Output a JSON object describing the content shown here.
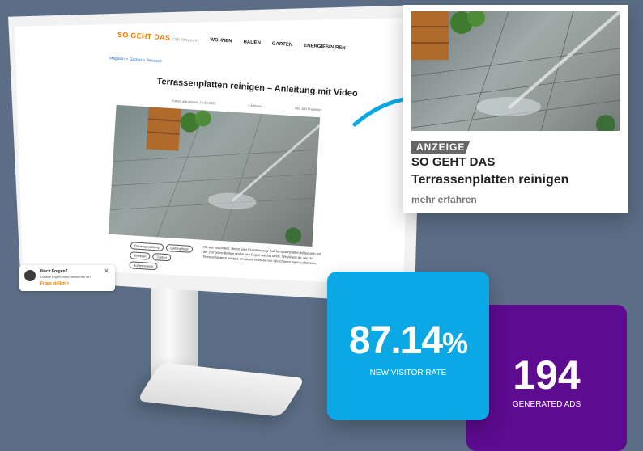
{
  "site": {
    "logo": "SO GEHT DAS",
    "logo_sub": "OBI Magazin",
    "nav": [
      "WOHNEN",
      "BAUEN",
      "GARTEN",
      "ENERGIESPAREN"
    ],
    "breadcrumb": "Magazin  >  Garten  >  Terrasse",
    "headline": "Terrassenplatten reinigen – Anleitung mit Video",
    "meta": [
      "Zuletzt aktualisiert: 15.08.2023",
      "5 Minuten",
      "inkl. 100 Projekten"
    ],
    "tags": [
      "Gartengestaltung",
      "Gartenpflege",
      "Terrasse",
      "Garten",
      "Außenbereich"
    ],
    "lead": "Ob aus Naturstein, Beton oder Feinsteinzeug: Auf Terrassenplatten bilden sich mit der Zeit grüne Beläge und in den Fugen wächst Moos. Wir zeigen dir, wie du Terrassenplatten reinigst, um deine Terrasse von Verschmutzungen zu befreien.",
    "inhalt": "Inhalt",
    "help_title": "Noch Fragen?",
    "help_text": "Unsere Expert:innen antworten dir!",
    "help_cta": "Frage stellen  >"
  },
  "ad": {
    "badge": "ANZEIGE",
    "brand": "SO GEHT DAS",
    "title": "Terrassenplatten reinigen",
    "cta": "mehr erfahren"
  },
  "stats": {
    "visitor_rate": "87.14",
    "visitor_rate_unit": "%",
    "visitor_label": "NEW VISITOR RATE",
    "ads": "194",
    "ads_label": "GENERATED ADS"
  },
  "colors": {
    "accent": "#f07d00",
    "stat_blue": "#0aa9e6",
    "stat_purple": "#5d0b8f",
    "background": "#5b6e86"
  }
}
